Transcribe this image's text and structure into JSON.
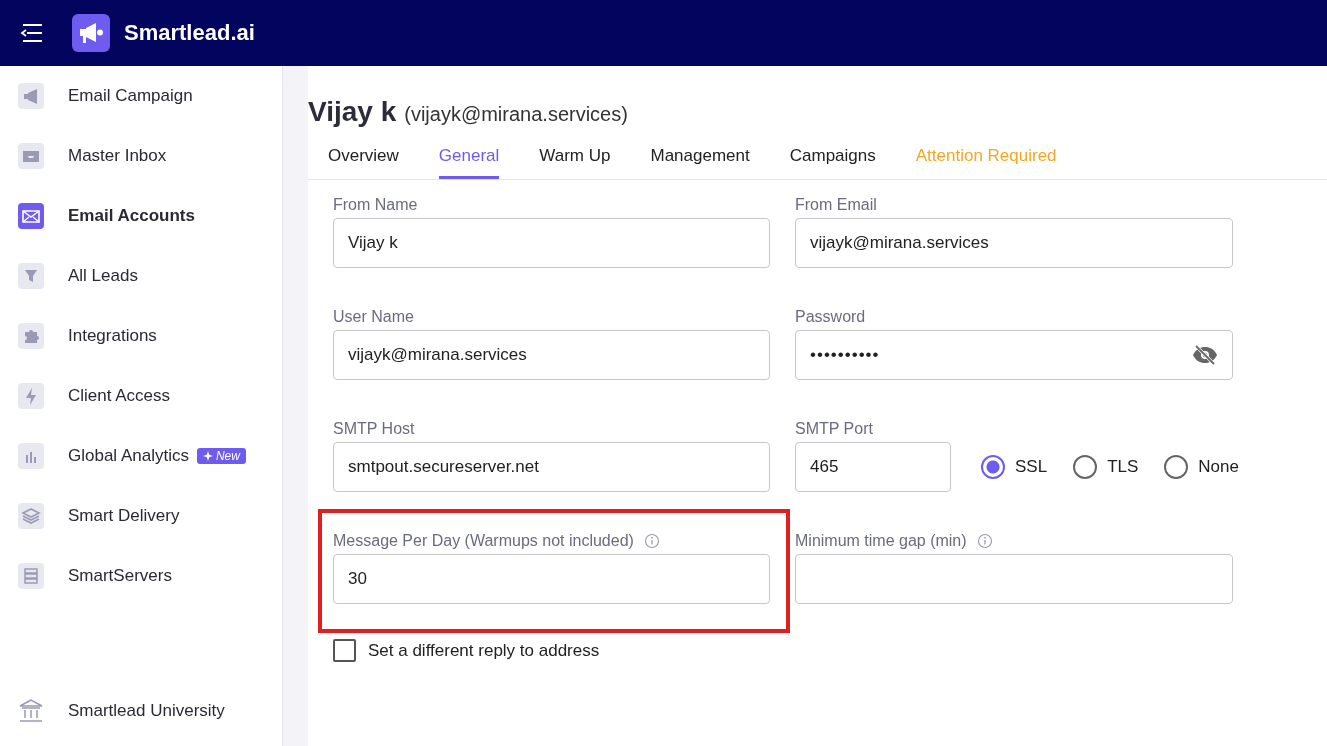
{
  "header": {
    "brand": "Smartlead.ai"
  },
  "sidebar": {
    "items": [
      {
        "label": "Email Campaign",
        "selected": false
      },
      {
        "label": "Master Inbox",
        "selected": false
      },
      {
        "label": "Email Accounts",
        "selected": true
      },
      {
        "label": "All Leads",
        "selected": false
      },
      {
        "label": "Integrations",
        "selected": false
      },
      {
        "label": "Client Access",
        "selected": false
      },
      {
        "label": "Global Analytics",
        "selected": false,
        "badge": "New"
      },
      {
        "label": "Smart Delivery",
        "selected": false
      },
      {
        "label": "SmartServers",
        "selected": false
      }
    ],
    "footer_item": {
      "label": "Smartlead University"
    }
  },
  "account": {
    "name": "Vijay k",
    "email": "(vijayk@mirana.services)"
  },
  "tabs": [
    {
      "label": "Overview",
      "selected": false,
      "kind": "normal"
    },
    {
      "label": "General",
      "selected": true,
      "kind": "normal"
    },
    {
      "label": "Warm Up",
      "selected": false,
      "kind": "normal"
    },
    {
      "label": "Management",
      "selected": false,
      "kind": "normal"
    },
    {
      "label": "Campaigns",
      "selected": false,
      "kind": "normal"
    },
    {
      "label": "Attention Required",
      "selected": false,
      "kind": "warning"
    }
  ],
  "form": {
    "rows": [
      {
        "fields": [
          {
            "label": "From Name",
            "value": "Vijay k",
            "kind": "text"
          },
          {
            "label": "From Email",
            "value": "vijayk@mirana.services",
            "kind": "text"
          }
        ]
      },
      {
        "fields": [
          {
            "label": "User Name",
            "value": "vijayk@mirana.services",
            "kind": "text"
          },
          {
            "label": "Password",
            "value": "••••••••••",
            "kind": "password"
          }
        ]
      },
      {
        "fields": [
          {
            "label": "SMTP Host",
            "value": "smtpout.secureserver.net",
            "kind": "text"
          },
          {
            "label": "SMTP Port",
            "value": "465",
            "kind": "port",
            "options": [
              {
                "label": "SSL",
                "selected": true
              },
              {
                "label": "TLS",
                "selected": false
              },
              {
                "label": "None",
                "selected": false
              }
            ]
          }
        ]
      },
      {
        "fields": [
          {
            "label": "Message Per Day (Warmups not included)",
            "value": "30",
            "kind": "text",
            "info": true,
            "highlighted": true
          },
          {
            "label": "Minimum time gap (min)",
            "kind": "text",
            "info": true
          }
        ]
      }
    ],
    "reply_to": {
      "label": "Set a different reply to address",
      "checked": false
    }
  }
}
